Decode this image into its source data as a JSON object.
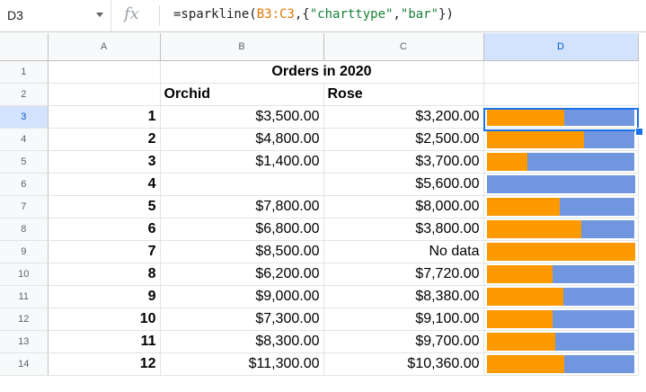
{
  "name_box": "D3",
  "fx_label": "fx",
  "formula": {
    "prefix": "=sparkline(",
    "ref": "B3:C3",
    "mid": ",{",
    "s1": "\"charttype\"",
    "comma": ",",
    "s2": "\"bar\"",
    "suffix": "})"
  },
  "columns": [
    "A",
    "B",
    "C",
    "D"
  ],
  "row_numbers": [
    "1",
    "2",
    "3",
    "4",
    "5",
    "6",
    "7",
    "8",
    "9",
    "10",
    "11",
    "12",
    "13",
    "14"
  ],
  "title": "Orders in 2020",
  "headers": {
    "orchid": "Orchid",
    "rose": "Rose"
  },
  "rows": [
    {
      "n": "1",
      "orchid": "$3,500.00",
      "rose": "$3,200.00",
      "orchid_value": 3500,
      "rose_value": 3200
    },
    {
      "n": "2",
      "orchid": "$4,800.00",
      "rose": "$2,500.00",
      "orchid_value": 4800,
      "rose_value": 2500
    },
    {
      "n": "3",
      "orchid": "$1,400.00",
      "rose": "$3,700.00",
      "orchid_value": 1400,
      "rose_value": 3700
    },
    {
      "n": "4",
      "orchid": "",
      "rose": "$5,600.00",
      "orchid_value": 0,
      "rose_value": 5600
    },
    {
      "n": "5",
      "orchid": "$7,800.00",
      "rose": "$8,000.00",
      "orchid_value": 7800,
      "rose_value": 8000
    },
    {
      "n": "6",
      "orchid": "$6,800.00",
      "rose": "$3,800.00",
      "orchid_value": 6800,
      "rose_value": 3800
    },
    {
      "n": "7",
      "orchid": "$8,500.00",
      "rose": "No data",
      "orchid_value": 8500,
      "rose_value": 0
    },
    {
      "n": "8",
      "orchid": "$6,200.00",
      "rose": "$7,720.00",
      "orchid_value": 6200,
      "rose_value": 7720
    },
    {
      "n": "9",
      "orchid": "$9,000.00",
      "rose": "$8,380.00",
      "orchid_value": 9000,
      "rose_value": 8380
    },
    {
      "n": "10",
      "orchid": "$7,300.00",
      "rose": "$9,100.00",
      "orchid_value": 7300,
      "rose_value": 9100
    },
    {
      "n": "11",
      "orchid": "$8,300.00",
      "rose": "$9,700.00",
      "orchid_value": 8300,
      "rose_value": 9700
    },
    {
      "n": "12",
      "orchid": "$11,300.00",
      "rose": "$10,360.00",
      "orchid_value": 11300,
      "rose_value": 10360
    }
  ],
  "colors": {
    "orchid_bar": "#ff9900",
    "rose_bar": "#6f96df",
    "selection": "#1a73e8"
  }
}
